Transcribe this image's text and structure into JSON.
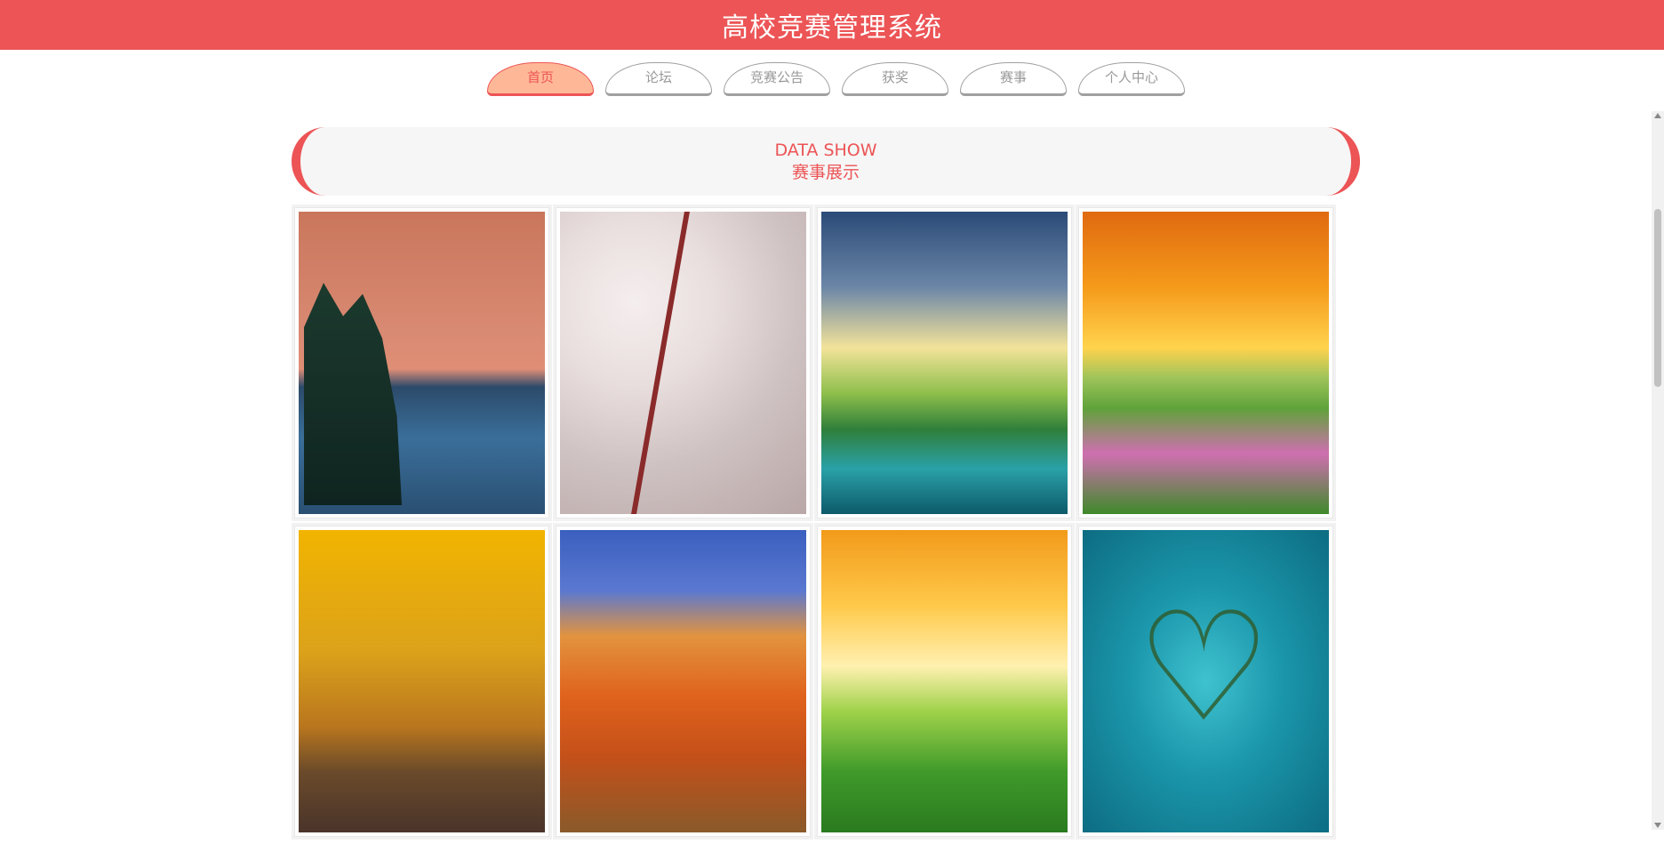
{
  "header": {
    "title": "高校竞赛管理系统"
  },
  "nav": {
    "tabs": [
      {
        "label": "首页",
        "active": true
      },
      {
        "label": "论坛",
        "active": false
      },
      {
        "label": "竞赛公告",
        "active": false
      },
      {
        "label": "获奖",
        "active": false
      },
      {
        "label": "赛事",
        "active": false
      },
      {
        "label": "个人中心",
        "active": false
      }
    ]
  },
  "section": {
    "title_en": "DATA SHOW",
    "title_cn": "赛事展示"
  },
  "gallery": {
    "items": [
      {
        "image": "lake-sunset-moon"
      },
      {
        "image": "cherry-blossoms"
      },
      {
        "image": "mountain-lake-sunrise"
      },
      {
        "image": "flower-field-sunset"
      },
      {
        "image": "autumn-tree-avenue"
      },
      {
        "image": "red-mountain"
      },
      {
        "image": "daisy-meadow"
      },
      {
        "image": "heart-island"
      }
    ]
  },
  "colors": {
    "accent": "#ec5456",
    "active_tab": "#ffb897",
    "banner_bg": "#f6f6f6"
  }
}
